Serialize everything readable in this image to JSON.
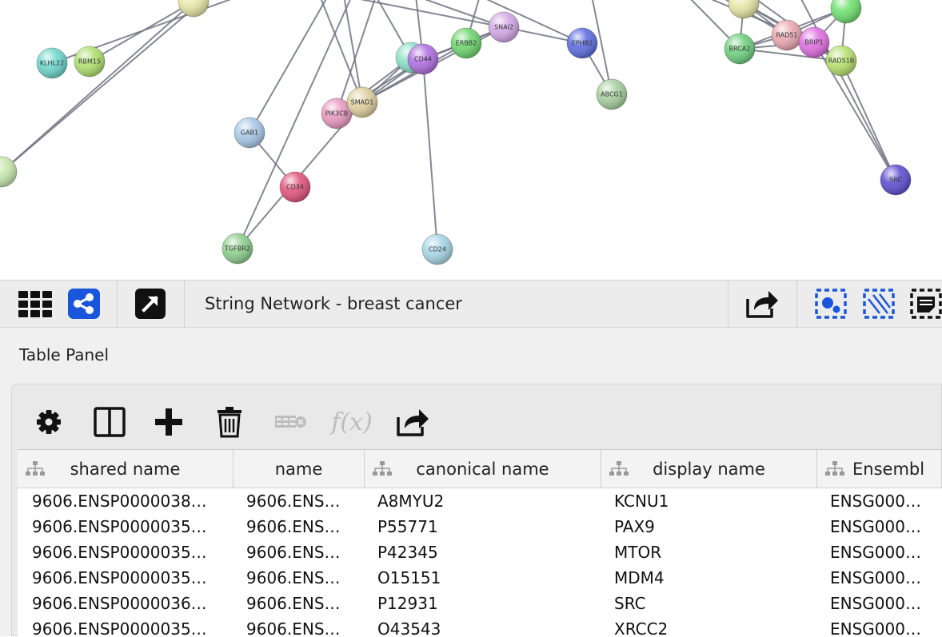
{
  "network": {
    "nodes": [
      {
        "label": "",
        "color": "#e6e6a8"
      },
      {
        "label": "KLHL22",
        "color": "#6fd6cc"
      },
      {
        "label": "RBM15",
        "color": "#b0e070"
      },
      {
        "label": "",
        "color": "#c8e8b0"
      },
      {
        "label": "GAB1",
        "color": "#a9c9e6"
      },
      {
        "label": "CD34",
        "color": "#e0567d"
      },
      {
        "label": "TGFBR2",
        "color": "#8fd08f"
      },
      {
        "label": "PIK3CB",
        "color": "#e89ac0"
      },
      {
        "label": "SMAD1",
        "color": "#e0d0a0"
      },
      {
        "label": "",
        "color": "#8fe0c8"
      },
      {
        "label": "CD44",
        "color": "#b070e0"
      },
      {
        "label": "ERBB2",
        "color": "#6fd66f"
      },
      {
        "label": "SNAI2",
        "color": "#d2a8e6"
      },
      {
        "label": "EPHB2",
        "color": "#5f6ee0"
      },
      {
        "label": "ABCG1",
        "color": "#a8d0a0"
      },
      {
        "label": "CD24",
        "color": "#a8d6e6"
      },
      {
        "label": "",
        "color": "#e6e6a8"
      },
      {
        "label": "",
        "color": "#70e070"
      },
      {
        "label": "BRCA2",
        "color": "#70d080"
      },
      {
        "label": "RAD51",
        "color": "#e8a8b0"
      },
      {
        "label": "BRIP1",
        "color": "#e070e0"
      },
      {
        "label": "RAD51B",
        "color": "#b8e070"
      },
      {
        "label": "SRC",
        "color": "#5f50d0"
      }
    ]
  },
  "toolbar": {
    "title": "String Network - breast cancer"
  },
  "table_panel": {
    "title": "Table Panel",
    "fx_label": "f(x)",
    "columns": [
      {
        "label": "shared name"
      },
      {
        "label": "name"
      },
      {
        "label": "canonical name"
      },
      {
        "label": "display name"
      },
      {
        "label": "Ensembl"
      }
    ],
    "rows": [
      {
        "shared_name": "9606.ENSP0000038…",
        "name": "9606.ENS…",
        "canonical": "A8MYU2",
        "display": "KCNU1",
        "ensembl": "ENSG000…"
      },
      {
        "shared_name": "9606.ENSP0000035…",
        "name": "9606.ENS…",
        "canonical": "P55771",
        "display": "PAX9",
        "ensembl": "ENSG000…"
      },
      {
        "shared_name": "9606.ENSP0000035…",
        "name": "9606.ENS…",
        "canonical": "P42345",
        "display": "MTOR",
        "ensembl": "ENSG000…"
      },
      {
        "shared_name": "9606.ENSP0000035…",
        "name": "9606.ENS…",
        "canonical": "O15151",
        "display": "MDM4",
        "ensembl": "ENSG000…"
      },
      {
        "shared_name": "9606.ENSP0000036…",
        "name": "9606.ENS…",
        "canonical": "P12931",
        "display": "SRC",
        "ensembl": "ENSG000…"
      },
      {
        "shared_name": "9606.ENSP0000035…",
        "name": "9606.ENS…",
        "canonical": "O43543",
        "display": "XRCC2",
        "ensembl": "ENSG000…"
      }
    ]
  },
  "colors": {
    "accent_blue": "#1a56db",
    "toolbar_bg": "#ececec",
    "edge": "#6e7380"
  }
}
